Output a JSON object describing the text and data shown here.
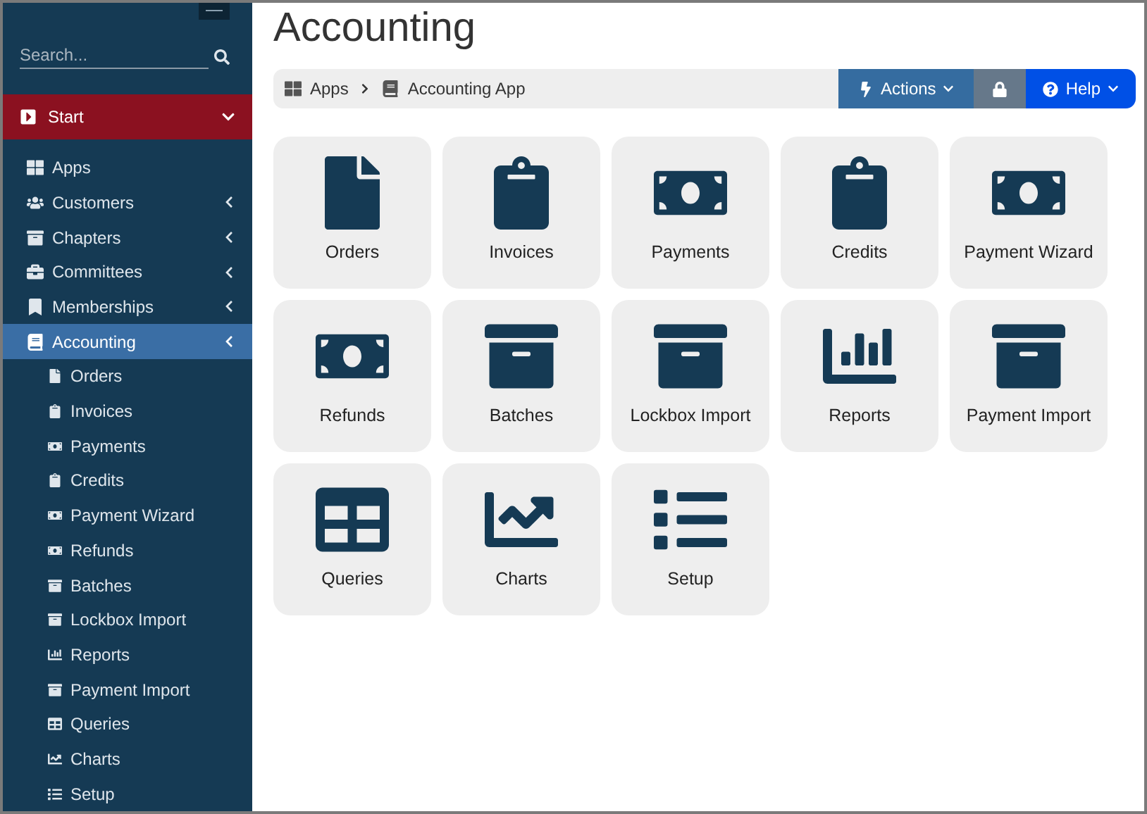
{
  "sidebar": {
    "search": {
      "placeholder": "Search..."
    },
    "start": {
      "label": "Start",
      "expanded": true
    },
    "items": [
      {
        "label": "Apps",
        "kind": "apps",
        "has_submenu": false,
        "selected": false
      },
      {
        "label": "Customers",
        "kind": "users",
        "has_submenu": true,
        "selected": false
      },
      {
        "label": "Chapters",
        "kind": "archive",
        "has_submenu": true,
        "selected": false
      },
      {
        "label": "Committees",
        "kind": "briefcase",
        "has_submenu": true,
        "selected": false
      },
      {
        "label": "Memberships",
        "kind": "bookmark",
        "has_submenu": true,
        "selected": false
      },
      {
        "label": "Accounting",
        "kind": "book",
        "has_submenu": true,
        "selected": true,
        "children": [
          {
            "label": "Orders",
            "kind": "file"
          },
          {
            "label": "Invoices",
            "kind": "clipboard"
          },
          {
            "label": "Payments",
            "kind": "money"
          },
          {
            "label": "Credits",
            "kind": "clipboard"
          },
          {
            "label": "Payment Wizard",
            "kind": "money"
          },
          {
            "label": "Refunds",
            "kind": "money"
          },
          {
            "label": "Batches",
            "kind": "archive"
          },
          {
            "label": "Lockbox Import",
            "kind": "archive"
          },
          {
            "label": "Reports",
            "kind": "bars"
          },
          {
            "label": "Payment Import",
            "kind": "archive"
          },
          {
            "label": "Queries",
            "kind": "table"
          },
          {
            "label": "Charts",
            "kind": "line"
          },
          {
            "label": "Setup",
            "kind": "list"
          }
        ]
      }
    ]
  },
  "page": {
    "title": "Accounting"
  },
  "breadcrumb": [
    {
      "label": "Apps",
      "kind": "apps"
    },
    {
      "label": "Accounting App",
      "kind": "book"
    }
  ],
  "toolbar": {
    "actions": "Actions",
    "help": "Help"
  },
  "tiles": [
    {
      "label": "Orders",
      "kind": "file"
    },
    {
      "label": "Invoices",
      "kind": "clipboard"
    },
    {
      "label": "Payments",
      "kind": "money"
    },
    {
      "label": "Credits",
      "kind": "clipboard"
    },
    {
      "label": "Payment Wizard",
      "kind": "money"
    },
    {
      "label": "Refunds",
      "kind": "money"
    },
    {
      "label": "Batches",
      "kind": "archive"
    },
    {
      "label": "Lockbox Import",
      "kind": "archive"
    },
    {
      "label": "Reports",
      "kind": "bars"
    },
    {
      "label": "Payment Import",
      "kind": "archive"
    },
    {
      "label": "Queries",
      "kind": "table"
    },
    {
      "label": "Charts",
      "kind": "line"
    },
    {
      "label": "Setup",
      "kind": "list"
    }
  ]
}
